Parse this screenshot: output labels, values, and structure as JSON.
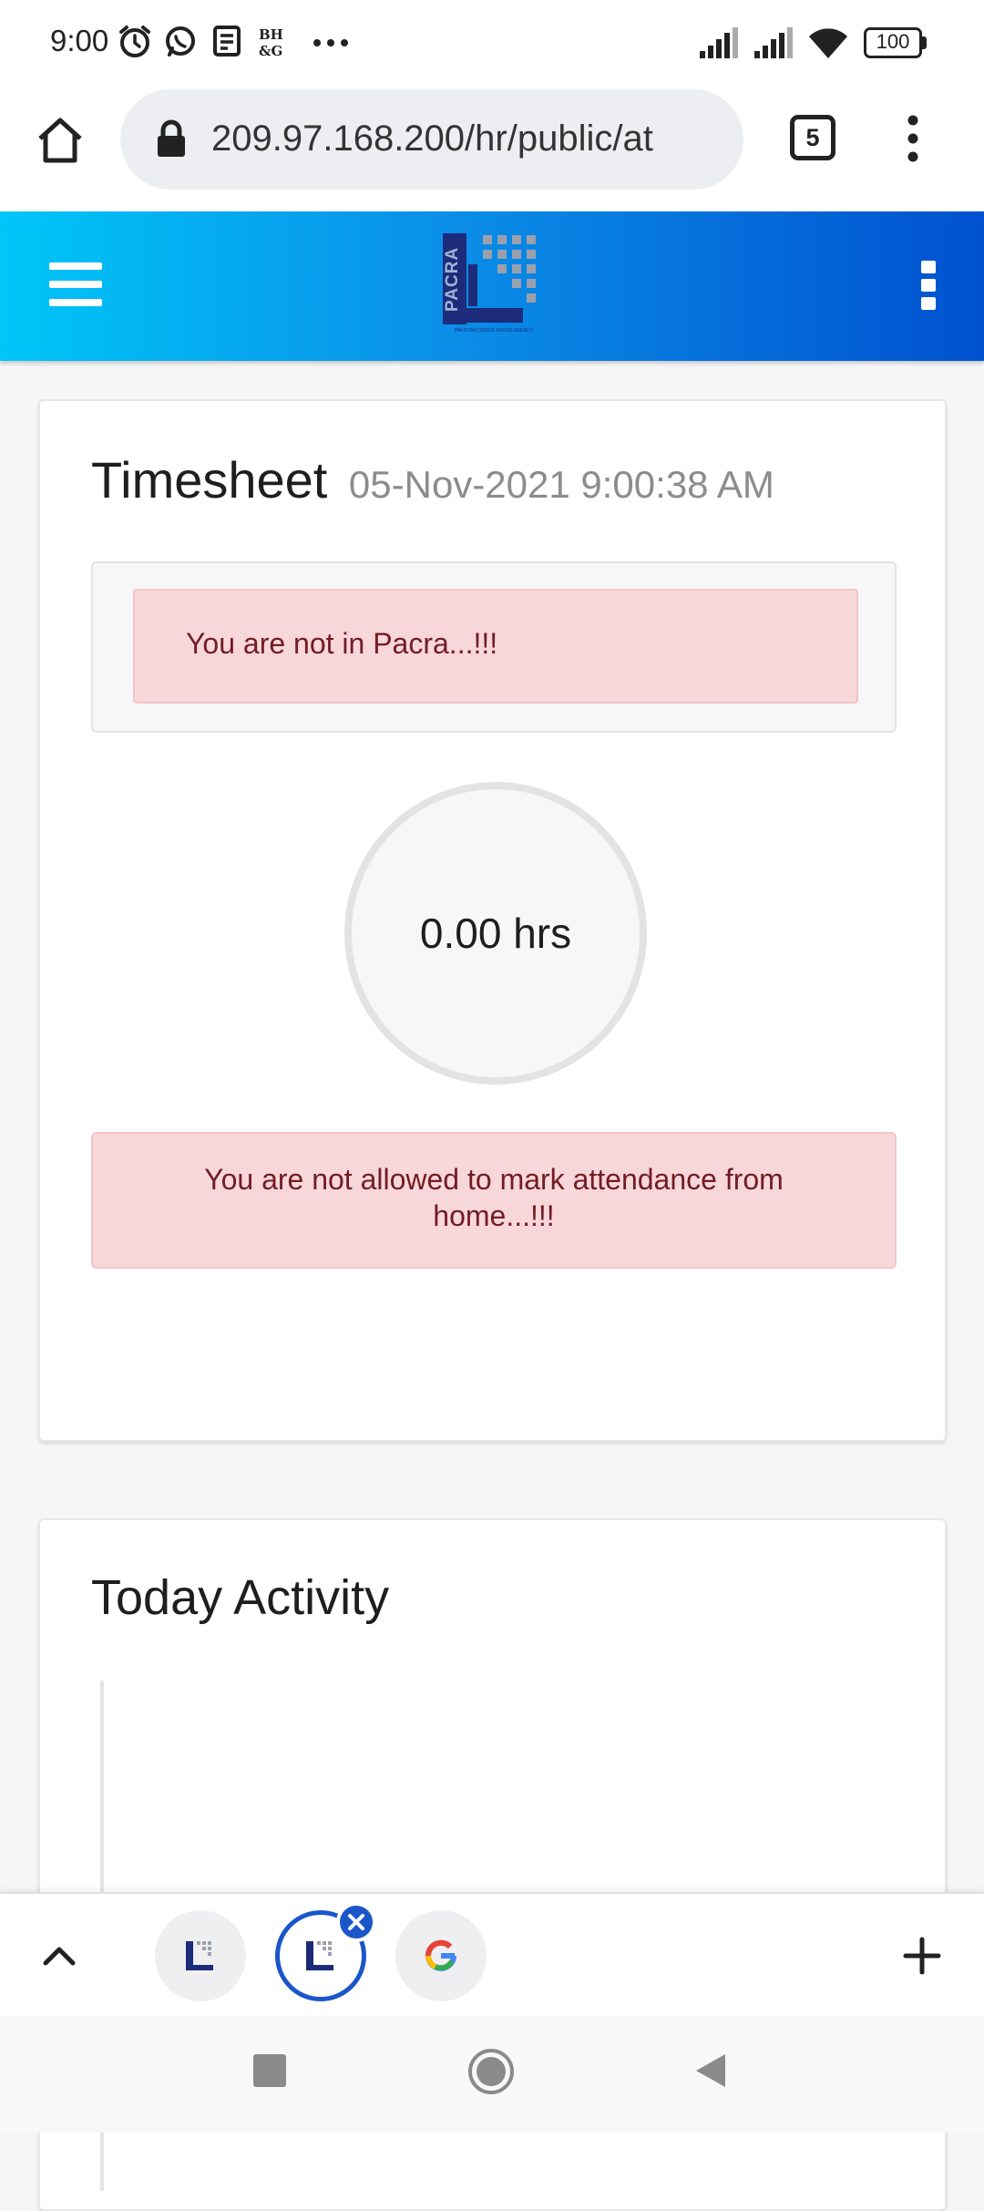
{
  "status_bar": {
    "time": "9:00",
    "battery": "100",
    "notification_icons": [
      "alarm-icon",
      "whatsapp-icon",
      "news-icon",
      "bhg-icon",
      "more-dots-icon"
    ]
  },
  "browser": {
    "url": "209.97.168.200/hr/public/at",
    "tab_count": "5"
  },
  "app_header": {
    "logo_text": "PACRA",
    "logo_subtext": "PAKISTAN CREDIT RATING AGENCY"
  },
  "timesheet": {
    "title": "Timesheet",
    "datetime": "05-Nov-2021 9:00:38 AM",
    "location_alert": "You are not in Pacra...!!!",
    "hours_display": "0.00 hrs",
    "home_alert": "You are not allowed to mark attendance from home...!!!"
  },
  "activity": {
    "title": "Today Activity"
  },
  "colors": {
    "header_gradient_start": "#00c6f8",
    "header_gradient_end": "#0051cf",
    "alert_bg": "#f8d7da",
    "alert_text": "#721c24",
    "active_tab": "#1a56c9"
  }
}
